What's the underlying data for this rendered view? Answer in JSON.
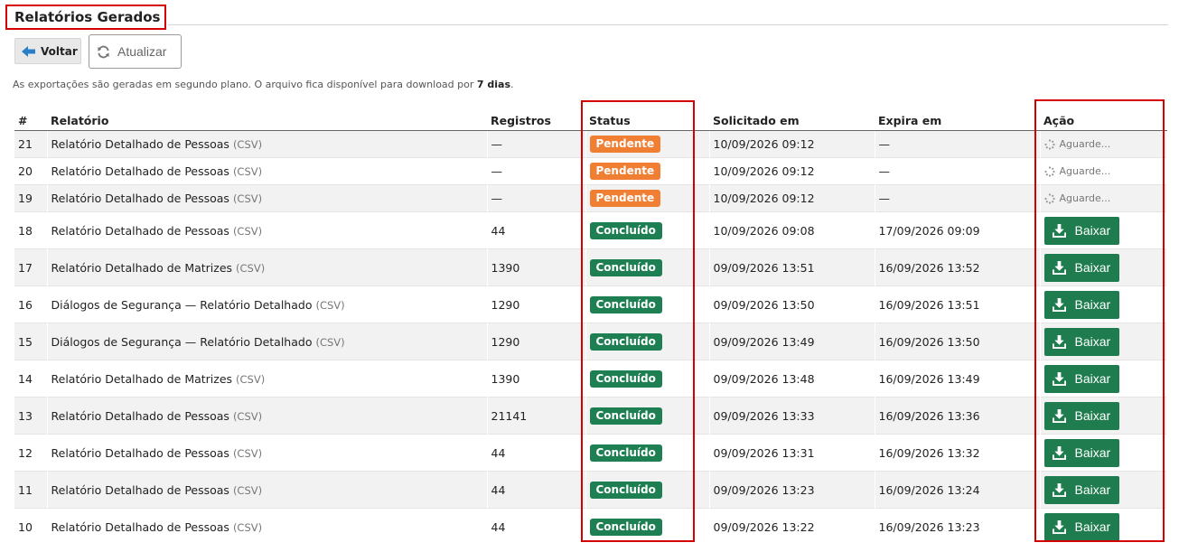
{
  "page": {
    "title": "Relatórios Gerados",
    "back_label": "Voltar",
    "refresh_label": "Atualizar",
    "info_prefix": "As exportações são geradas em segundo plano. O arquivo fica disponível para download por",
    "info_bold": "7 dias",
    "info_suffix": "."
  },
  "table": {
    "headers": [
      "#",
      "Relatório",
      "Registros",
      "Status",
      "Solicitado em",
      "Expira em",
      "Ação"
    ],
    "rows": [
      {
        "id": "21",
        "name": "Relatório Detalhado de Pessoas",
        "format": "(CSV)",
        "records": "—",
        "status": "Pendente",
        "requested": "10/09/2026 09:12",
        "expires": "—",
        "action": "Aguarde..."
      },
      {
        "id": "20",
        "name": "Relatório Detalhado de Pessoas",
        "format": "(CSV)",
        "records": "—",
        "status": "Pendente",
        "requested": "10/09/2026 09:12",
        "expires": "—",
        "action": "Aguarde..."
      },
      {
        "id": "19",
        "name": "Relatório Detalhado de Pessoas",
        "format": "(CSV)",
        "records": "—",
        "status": "Pendente",
        "requested": "10/09/2026 09:12",
        "expires": "—",
        "action": "Aguarde..."
      },
      {
        "id": "18",
        "name": "Relatório Detalhado de Pessoas",
        "format": "(CSV)",
        "records": "44",
        "status": "Concluído",
        "requested": "10/09/2026 09:08",
        "expires": "17/09/2026 09:09",
        "action": "Baixar"
      },
      {
        "id": "17",
        "name": "Relatório Detalhado de Matrizes",
        "format": "(CSV)",
        "records": "1390",
        "status": "Concluído",
        "requested": "09/09/2026 13:51",
        "expires": "16/09/2026 13:52",
        "action": "Baixar"
      },
      {
        "id": "16",
        "name": "Diálogos de Segurança — Relatório Detalhado",
        "format": "(CSV)",
        "records": "1290",
        "status": "Concluído",
        "requested": "09/09/2026 13:50",
        "expires": "16/09/2026 13:51",
        "action": "Baixar"
      },
      {
        "id": "15",
        "name": "Diálogos de Segurança — Relatório Detalhado",
        "format": "(CSV)",
        "records": "1290",
        "status": "Concluído",
        "requested": "09/09/2026 13:49",
        "expires": "16/09/2026 13:50",
        "action": "Baixar"
      },
      {
        "id": "14",
        "name": "Relatório Detalhado de Matrizes",
        "format": "(CSV)",
        "records": "1390",
        "status": "Concluído",
        "requested": "09/09/2026 13:48",
        "expires": "16/09/2026 13:49",
        "action": "Baixar"
      },
      {
        "id": "13",
        "name": "Relatório Detalhado de Pessoas",
        "format": "(CSV)",
        "records": "21141",
        "status": "Concluído",
        "requested": "09/09/2026 13:33",
        "expires": "16/09/2026 13:36",
        "action": "Baixar"
      },
      {
        "id": "12",
        "name": "Relatório Detalhado de Pessoas",
        "format": "(CSV)",
        "records": "44",
        "status": "Concluído",
        "requested": "09/09/2026 13:31",
        "expires": "16/09/2026 13:32",
        "action": "Baixar"
      },
      {
        "id": "11",
        "name": "Relatório Detalhado de Pessoas",
        "format": "(CSV)",
        "records": "44",
        "status": "Concluído",
        "requested": "09/09/2026 13:23",
        "expires": "16/09/2026 13:24",
        "action": "Baixar"
      },
      {
        "id": "10",
        "name": "Relatório Detalhado de Pessoas",
        "format": "(CSV)",
        "records": "44",
        "status": "Concluído",
        "requested": "09/09/2026 13:22",
        "expires": "16/09/2026 13:23",
        "action": "Baixar"
      }
    ]
  },
  "colors": {
    "pending": "#f07f34",
    "done": "#1d7f52",
    "download_button": "#1e7c4e",
    "highlight": "#d40000"
  },
  "icons": {
    "back": "arrow-left-icon",
    "refresh": "refresh-icon",
    "waiting": "spinner-icon",
    "download": "download-icon"
  }
}
